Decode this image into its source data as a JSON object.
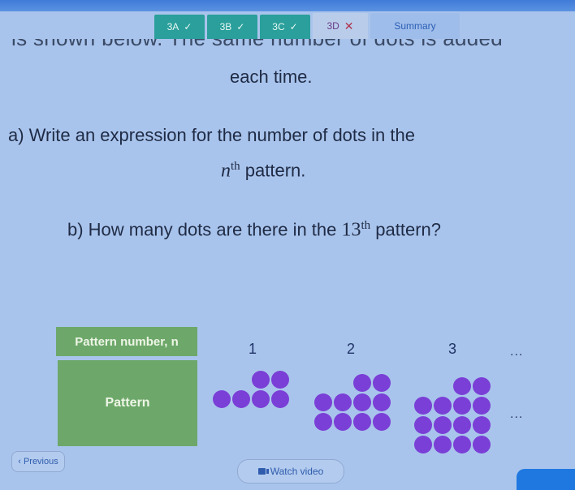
{
  "tabs": [
    {
      "label": "3A",
      "status": "✓",
      "state": "correct"
    },
    {
      "label": "3B",
      "status": "✓",
      "state": "correct"
    },
    {
      "label": "3C",
      "status": "✓",
      "state": "correct"
    },
    {
      "label": "3D",
      "status": "✕",
      "state": "incorrect-active"
    },
    {
      "label": "Summary",
      "status": "",
      "state": "summary"
    }
  ],
  "question": {
    "cut_line": "is shown below. The same number of dots is added",
    "intro_end": "each time.",
    "part_a_line1": "a) Write an expression for the number of dots in the",
    "part_a_var": "n",
    "part_a_sup": "th",
    "part_a_line2": " pattern.",
    "part_b_prefix": "b) How many dots are there in the ",
    "part_b_num": "13",
    "part_b_sup": "th",
    "part_b_suffix": " pattern?"
  },
  "table": {
    "header": "Pattern number, n",
    "row_label": "Pattern",
    "pattern_numbers": [
      "1",
      "2",
      "3"
    ],
    "ellipsis": "...",
    "dot_counts": [
      6,
      10,
      14
    ],
    "dot_color": "#7a3fd6"
  },
  "footer": {
    "previous_label": "Previous",
    "previous_icon": "chevron-left-icon",
    "watch_video_label": "Watch video",
    "watch_video_icon": "video-camera-icon"
  }
}
